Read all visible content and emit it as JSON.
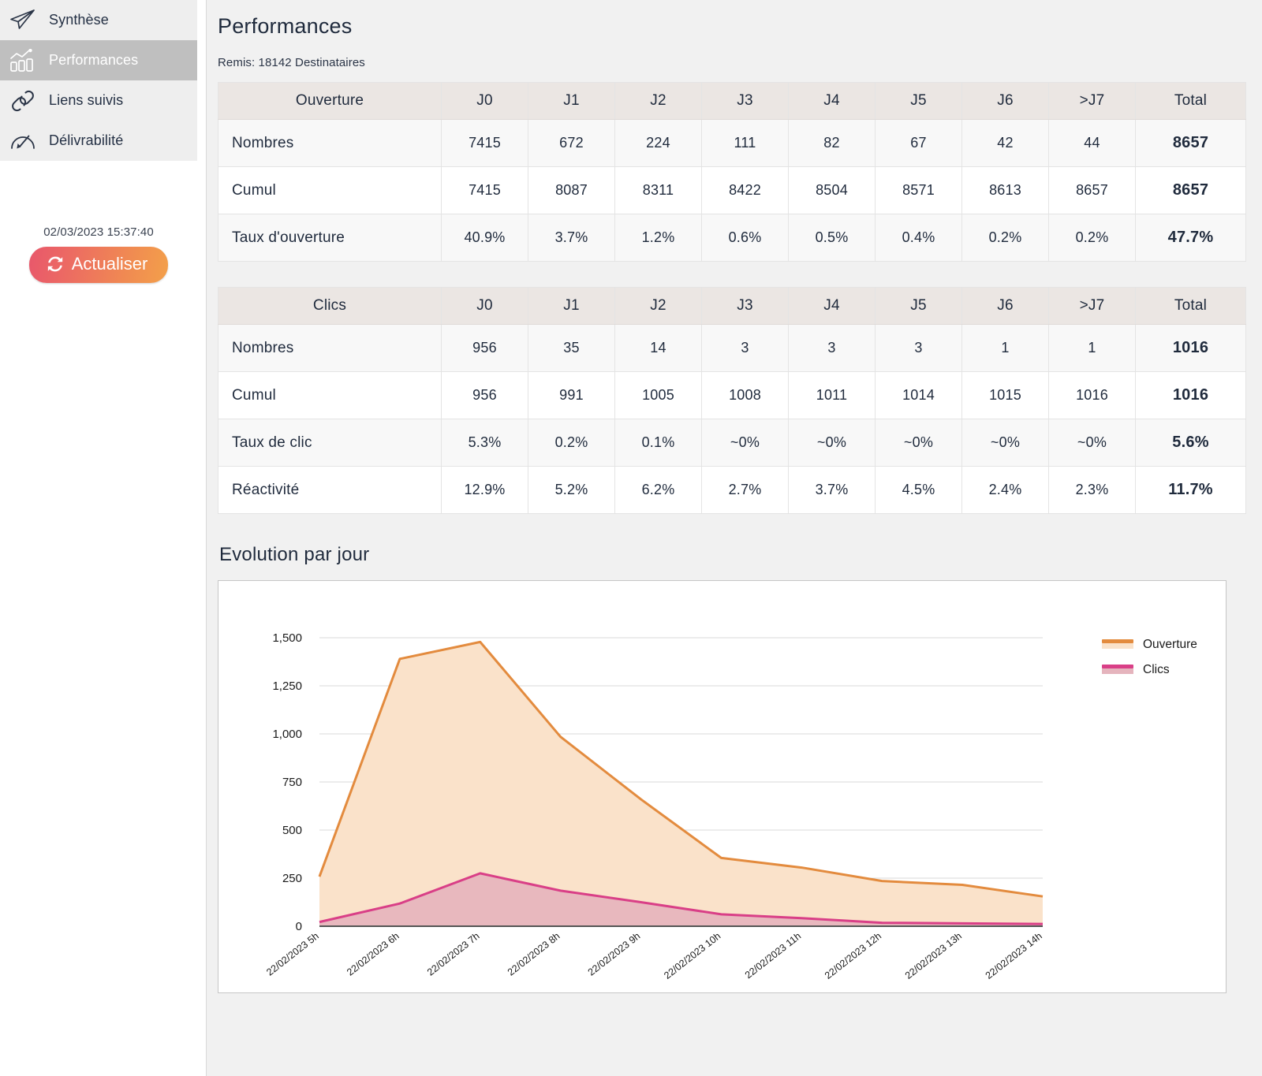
{
  "sidebar": {
    "items": [
      {
        "label": "Synthèse",
        "icon": "paper-plane-icon",
        "active": false
      },
      {
        "label": "Performances",
        "icon": "bar-chart-icon",
        "active": true
      },
      {
        "label": "Liens suivis",
        "icon": "link-chain-icon",
        "active": false
      },
      {
        "label": "Délivrabilité",
        "icon": "gauge-icon",
        "active": false
      }
    ],
    "timestamp": "02/03/2023 15:37:40",
    "refresh_label": "Actualiser",
    "refresh_icon": "refresh-icon"
  },
  "header": {
    "title": "Performances",
    "subtitle": "Remis: 18142 Destinataires"
  },
  "tables": [
    {
      "name": "ouverture",
      "columns": [
        "Ouverture",
        "J0",
        "J1",
        "J2",
        "J3",
        "J4",
        "J5",
        "J6",
        ">J7",
        "Total"
      ],
      "rows": [
        {
          "label": "Nombres",
          "values": [
            "7415",
            "672",
            "224",
            "111",
            "82",
            "67",
            "42",
            "44"
          ],
          "total": "8657"
        },
        {
          "label": "Cumul",
          "values": [
            "7415",
            "8087",
            "8311",
            "8422",
            "8504",
            "8571",
            "8613",
            "8657"
          ],
          "total": "8657"
        },
        {
          "label": "Taux d'ouverture",
          "values": [
            "40.9%",
            "3.7%",
            "1.2%",
            "0.6%",
            "0.5%",
            "0.4%",
            "0.2%",
            "0.2%"
          ],
          "total": "47.7%"
        }
      ]
    },
    {
      "name": "clics",
      "columns": [
        "Clics",
        "J0",
        "J1",
        "J2",
        "J3",
        "J4",
        "J5",
        "J6",
        ">J7",
        "Total"
      ],
      "rows": [
        {
          "label": "Nombres",
          "values": [
            "956",
            "35",
            "14",
            "3",
            "3",
            "3",
            "1",
            "1"
          ],
          "total": "1016"
        },
        {
          "label": "Cumul",
          "values": [
            "956",
            "991",
            "1005",
            "1008",
            "1011",
            "1014",
            "1015",
            "1016"
          ],
          "total": "1016"
        },
        {
          "label": "Taux de clic",
          "values": [
            "5.3%",
            "0.2%",
            "0.1%",
            "~0%",
            "~0%",
            "~0%",
            "~0%",
            "~0%"
          ],
          "total": "5.6%"
        },
        {
          "label": "Réactivité",
          "values": [
            "12.9%",
            "5.2%",
            "6.2%",
            "2.7%",
            "3.7%",
            "4.5%",
            "2.4%",
            "2.3%"
          ],
          "total": "11.7%"
        }
      ]
    }
  ],
  "chart_section": {
    "title": "Evolution par jour"
  },
  "chart_data": {
    "type": "area",
    "title": "Evolution par jour",
    "xlabel": "",
    "ylabel": "",
    "ylim": [
      0,
      1500
    ],
    "yticks": [
      0,
      250,
      500,
      750,
      1000,
      1250,
      1500
    ],
    "ytick_labels": [
      "0",
      "250",
      "500",
      "750",
      "1,000",
      "1,250",
      "1,500"
    ],
    "grid": true,
    "legend_position": "right",
    "x": [
      "22/02/2023 5h",
      "22/02/2023 6h",
      "22/02/2023 7h",
      "22/02/2023 8h",
      "22/02/2023 9h",
      "22/02/2023 10h",
      "22/02/2023 11h",
      "22/02/2023 12h",
      "22/02/2023 13h",
      "22/02/2023 14h"
    ],
    "series": [
      {
        "name": "Ouverture",
        "color": "#E38B3E",
        "fill": "#FAE2CA",
        "values": [
          258,
          1390,
          1478,
          985,
          660,
          355,
          305,
          235,
          215,
          155
        ]
      },
      {
        "name": "Clics",
        "color": "#D93F87",
        "fill": "#E5B4BD",
        "values": [
          22,
          118,
          275,
          185,
          125,
          62,
          42,
          18,
          15,
          12
        ]
      }
    ]
  },
  "colors": {
    "accent_orange": "#E38B3E",
    "accent_pink": "#D93F87",
    "text_dark": "#1f2a3c",
    "header_bg": "#ebe6e3",
    "active_nav": "#bfbfbf"
  }
}
